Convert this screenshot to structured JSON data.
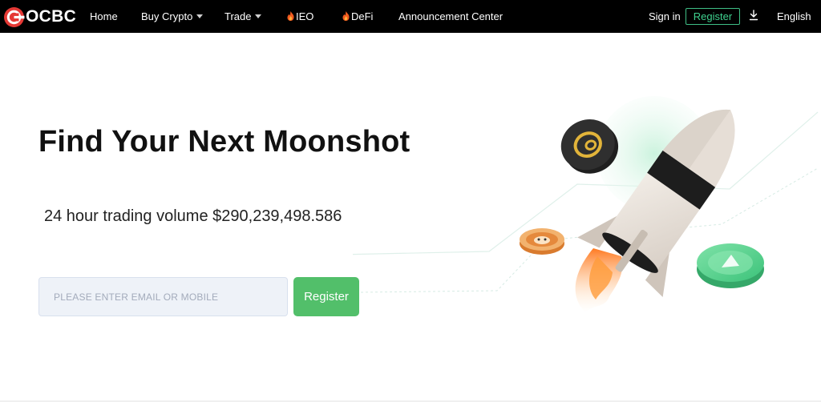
{
  "brand": {
    "name": "OCBC",
    "logo_color": "#e53935"
  },
  "nav": {
    "home": "Home",
    "buy_crypto": "Buy Crypto",
    "trade": "Trade",
    "ieo": "IEO",
    "defi": "DeFi",
    "announcement": "Announcement Center",
    "sign_in": "Sign in",
    "register": "Register",
    "language": "English",
    "icons": {
      "buy_crypto": "caret-down-icon",
      "trade": "caret-down-icon",
      "ieo": "fire-icon",
      "defi": "fire-icon",
      "download": "download-icon"
    },
    "register_color": "#3fd18f"
  },
  "hero": {
    "title": "Find Your Next Moonshot",
    "volume_label": "24 hour trading volume",
    "volume_value": "$290,239,498.586",
    "email_placeholder": "PLEASE ENTER EMAIL OR MOBILE",
    "email_value": "",
    "register_button": "Register",
    "register_button_color": "#52bf6a",
    "illustration": "rocket-with-coins-illustration"
  }
}
